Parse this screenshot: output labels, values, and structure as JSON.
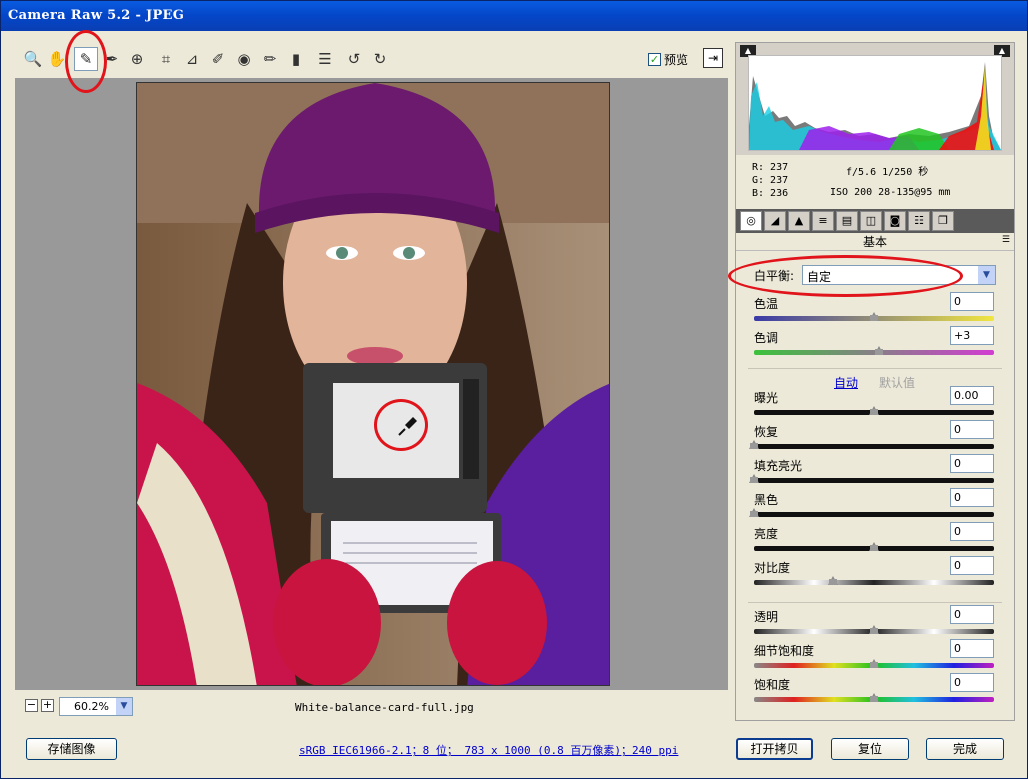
{
  "window": {
    "title": "Camera Raw 5.2 -  JPEG"
  },
  "toolbar": {
    "tools": [
      {
        "name": "zoom-tool-icon",
        "glyph": "🔍"
      },
      {
        "name": "hand-tool-icon",
        "glyph": "✋"
      },
      {
        "name": "white-balance-tool-icon",
        "glyph": "✎"
      },
      {
        "name": "color-sampler-tool-icon",
        "glyph": "✒"
      },
      {
        "name": "targeted-adjustment-tool-icon",
        "glyph": "⊕"
      },
      {
        "name": "crop-tool-icon",
        "glyph": "⌗"
      },
      {
        "name": "straighten-tool-icon",
        "glyph": "⊿"
      },
      {
        "name": "spot-removal-tool-icon",
        "glyph": "✐"
      },
      {
        "name": "red-eye-tool-icon",
        "glyph": "◉"
      },
      {
        "name": "adjustment-brush-icon",
        "glyph": "✏"
      },
      {
        "name": "graduated-filter-icon",
        "glyph": "▮"
      },
      {
        "name": "preferences-icon",
        "glyph": "☰"
      },
      {
        "name": "rotate-left-icon",
        "glyph": "↺"
      },
      {
        "name": "rotate-right-icon",
        "glyph": "↻"
      }
    ],
    "preview_label": "预览",
    "preview_checked": "✓",
    "fullscreen_glyph": "⇥"
  },
  "zoom": {
    "minus": "−",
    "plus": "+",
    "value": "60.2%",
    "dropdown_glyph": "▼"
  },
  "filename": "White-balance-card-full.jpg",
  "readout": {
    "r": "R:  237",
    "g": "G:  237",
    "b": "B:  236",
    "exposure": "f/5.6   1/250 秒",
    "iso_lens": "ISO 200   28-135@95 mm"
  },
  "histogram_clip": {
    "shadow": "▲",
    "highlight": "▲"
  },
  "panel_tabs": [
    "◎",
    "◢",
    "▲",
    "≡",
    "▤",
    "◫",
    "◙",
    "☷",
    "❐"
  ],
  "panel": {
    "section_title": "基本",
    "menu_glyph": "☰",
    "wb_label": "白平衡:",
    "wb_value": "自定",
    "wb_dropdown": "▼",
    "auto_link": "自动",
    "default_link": "默认值",
    "sliders": [
      {
        "label": "色温",
        "value": "0",
        "level": 0.5
      },
      {
        "label": "色调",
        "value": "+3",
        "level": 0.52
      },
      {
        "label": "曝光",
        "value": "0.00",
        "level": 0.5
      },
      {
        "label": "恢复",
        "value": "0",
        "level": 0.0
      },
      {
        "label": "填充亮光",
        "value": "0",
        "level": 0.0
      },
      {
        "label": "黑色",
        "value": "0",
        "level": 0.0
      },
      {
        "label": "亮度",
        "value": "0",
        "level": 0.5
      },
      {
        "label": "对比度",
        "value": "0",
        "level": 0.33
      },
      {
        "label": "透明",
        "value": "0",
        "level": 0.5
      },
      {
        "label": "细节饱和度",
        "value": "0",
        "level": 0.5
      },
      {
        "label": "饱和度",
        "value": "0",
        "level": 0.5
      }
    ]
  },
  "colors": {
    "temp_gradient": [
      "#3a3aa8",
      "#f0e640"
    ],
    "tint_gradient": [
      "#3cc23c",
      "#d23cd2"
    ],
    "accent_red": "#e0141a"
  },
  "buttons": {
    "save": "存储图像",
    "open_copy": "打开拷贝",
    "reset": "复位",
    "done": "完成"
  },
  "workflow_link": "sRGB IEC61966-2.1；8 位； 783 x 1000 (0.8 百万像素)；240 ppi"
}
